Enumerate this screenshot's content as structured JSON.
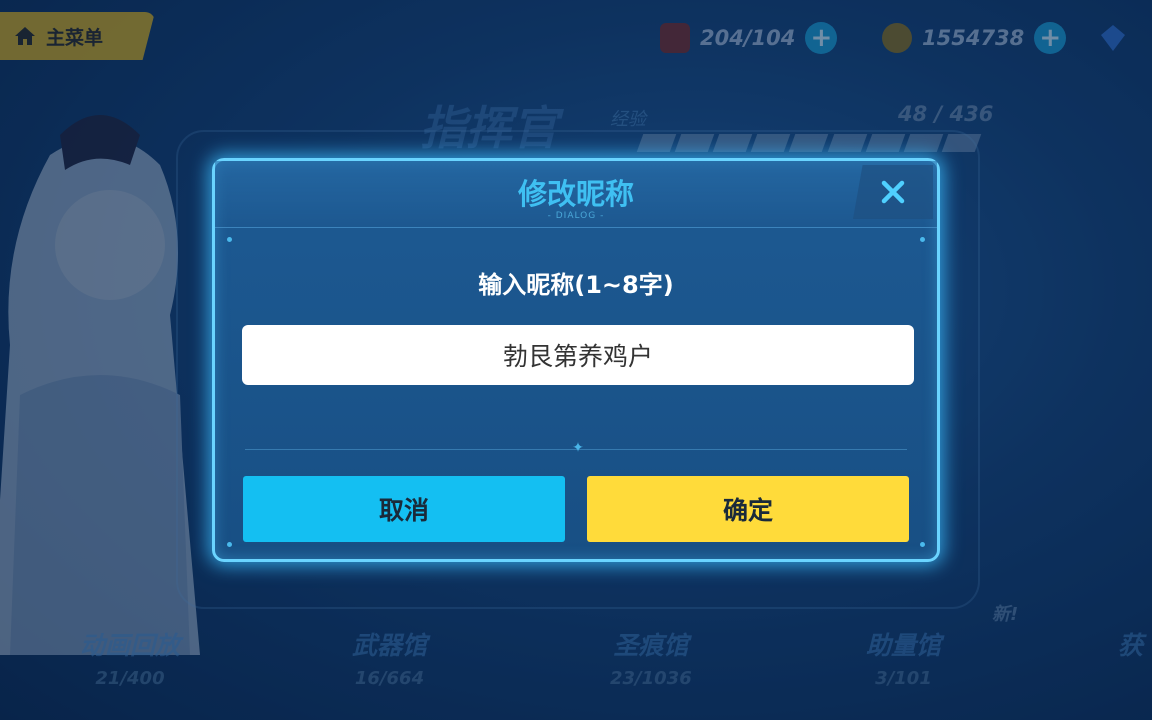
{
  "main_menu": {
    "label": "主菜单",
    "icon": "home-icon"
  },
  "resources": [
    {
      "icon": "stamina-icon",
      "value": "204/104",
      "color": "#c0392b"
    },
    {
      "icon": "coin-icon",
      "value": "1554738",
      "color": "#d4a11c"
    },
    {
      "icon": "crystal-icon",
      "value": "",
      "color": "#3fa0ff"
    }
  ],
  "background": {
    "title": "指挥官",
    "exp_label": "经验",
    "exp_value": "48 / 436",
    "new_badge": "新!",
    "bottom_items": [
      {
        "name": "动画回放",
        "count": "21/400"
      },
      {
        "name": "武器馆",
        "count": "16/664"
      },
      {
        "name": "圣痕馆",
        "count": "23/1036"
      },
      {
        "name": "助量馆",
        "count": "3/101"
      },
      {
        "name": "获",
        "count": ""
      }
    ]
  },
  "dialog": {
    "title": "修改昵称",
    "subtitle": "- DIALOG -",
    "prompt": "输入昵称(1~8字)",
    "input_value": "勃艮第养鸡户",
    "cancel_label": "取消",
    "confirm_label": "确定"
  },
  "colors": {
    "accent": "#3fc0f2",
    "cancel": "#14bff2",
    "confirm": "#ffdb3a",
    "dialog_border": "#6ad4ff"
  }
}
